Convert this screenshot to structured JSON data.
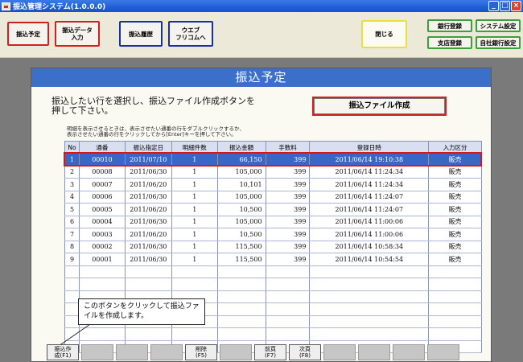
{
  "window": {
    "title": "振込管理システム(1.0.0.0)",
    "controls": [
      "_",
      "□",
      "×"
    ]
  },
  "toolbar": {
    "furikomi_yotei": "振込予定",
    "furikomi_data_line1": "振込データ",
    "furikomi_data_line2": "入力",
    "furikomi_rireki": "振込履歴",
    "web_line1": "ウエブ",
    "web_line2": "フリコムへ",
    "close": "閉じる",
    "ginko_toroku": "銀行登録",
    "shiten_toroku": "支店登録",
    "system_settei": "システム設定",
    "jisha_ginko_settei": "自社銀行設定"
  },
  "panel": {
    "title": "振込予定",
    "instruction_line1": "振込したい行を選択し、振込ファイル作成ボタンを",
    "instruction_line2": "押して下さい。",
    "create_file_button": "振込ファイル作成",
    "hint_line1": "明細を表示させるときは、表示させたい通番の行をダブルクリックするか、",
    "hint_line2": "表示させたい通番の行をクリックしてから[Enter]キーを押して下さい。"
  },
  "grid": {
    "columns": [
      "No",
      "通番",
      "振込指定日",
      "明細件数",
      "振込金額",
      "手数料",
      "登録日時",
      "入力区分"
    ],
    "rows": [
      [
        "1",
        "00010",
        "2011/07/10",
        "1",
        "66,150",
        "399",
        "2011/06/14 19:10:38",
        "販売"
      ],
      [
        "2",
        "00008",
        "2011/06/30",
        "1",
        "105,000",
        "399",
        "2011/06/14 11:24:34",
        "販売"
      ],
      [
        "3",
        "00007",
        "2011/06/20",
        "1",
        "10,101",
        "399",
        "2011/06/14 11:24:34",
        "販売"
      ],
      [
        "4",
        "00006",
        "2011/06/30",
        "1",
        "105,000",
        "399",
        "2011/06/14 11:24:07",
        "販売"
      ],
      [
        "5",
        "00005",
        "2011/06/20",
        "1",
        "10,500",
        "399",
        "2011/06/14 11:24:07",
        "販売"
      ],
      [
        "6",
        "00004",
        "2011/06/30",
        "1",
        "105,000",
        "399",
        "2011/06/14 11:00:06",
        "販売"
      ],
      [
        "7",
        "00003",
        "2011/06/20",
        "1",
        "10,500",
        "399",
        "2011/06/14 11:00:06",
        "販売"
      ],
      [
        "8",
        "00002",
        "2011/06/30",
        "1",
        "115,500",
        "399",
        "2011/06/14 10:58:34",
        "販売"
      ],
      [
        "9",
        "00001",
        "2011/06/30",
        "1",
        "115,500",
        "399",
        "2011/06/14 10:54:54",
        "販売"
      ]
    ],
    "selected_row": 0
  },
  "callout": {
    "line1": "このボタンをクリックして振込ファ",
    "line2": "イルを作成します。"
  },
  "fkeys": [
    {
      "line1": "振込作",
      "line2": "成(F1)",
      "enabled": true
    },
    {
      "line1": "",
      "line2": "",
      "enabled": false
    },
    {
      "line1": "",
      "line2": "",
      "enabled": false
    },
    {
      "line1": "",
      "line2": "",
      "enabled": false
    },
    {
      "line1": "削除",
      "line2": "(F5)",
      "enabled": true
    },
    {
      "line1": "",
      "line2": "",
      "enabled": false
    },
    {
      "line1": "前頁",
      "line2": "(F7)",
      "enabled": true
    },
    {
      "line1": "次頁",
      "line2": "(F8)",
      "enabled": true
    },
    {
      "line1": "",
      "line2": "",
      "enabled": false
    },
    {
      "line1": "",
      "line2": "",
      "enabled": false
    },
    {
      "line1": "",
      "line2": "",
      "enabled": false
    },
    {
      "line1": "",
      "line2": "",
      "enabled": false
    }
  ]
}
